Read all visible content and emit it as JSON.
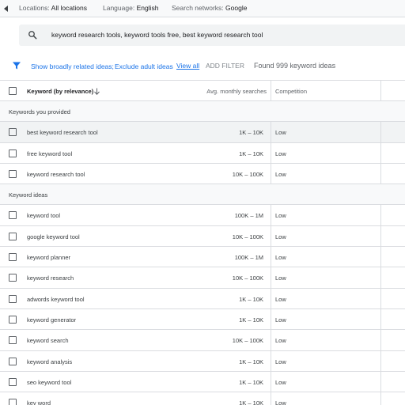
{
  "topbar": {
    "locations_label": "Locations:",
    "locations_value": "All locations",
    "language_label": "Language:",
    "language_value": "English",
    "networks_label": "Search networks:",
    "networks_value": "Google"
  },
  "search": {
    "query": "keyword research tools, keyword tools free, best keyword research tool"
  },
  "filters": {
    "broadly_related": "Show broadly related ideas;",
    "exclude_adult": "Exclude adult ideas",
    "view_all": "View all",
    "add_filter": "ADD FILTER",
    "found": "Found 999 keyword ideas"
  },
  "table": {
    "headers": {
      "keyword": "Keyword (by relevance)",
      "volume": "Avg. monthly searches",
      "competition": "Competition"
    },
    "provided_label": "Keywords you provided",
    "ideas_label": "Keyword ideas",
    "provided": [
      {
        "keyword": "best keyword research tool",
        "volume": "1K – 10K",
        "competition": "Low"
      },
      {
        "keyword": "free keyword tool",
        "volume": "1K – 10K",
        "competition": "Low"
      },
      {
        "keyword": "keyword research tool",
        "volume": "10K – 100K",
        "competition": "Low"
      }
    ],
    "ideas": [
      {
        "keyword": "keyword tool",
        "volume": "100K – 1M",
        "competition": "Low"
      },
      {
        "keyword": "google keyword tool",
        "volume": "10K – 100K",
        "competition": "Low"
      },
      {
        "keyword": "keyword planner",
        "volume": "100K – 1M",
        "competition": "Low"
      },
      {
        "keyword": "keyword research",
        "volume": "10K – 100K",
        "competition": "Low"
      },
      {
        "keyword": "adwords keyword tool",
        "volume": "1K – 10K",
        "competition": "Low"
      },
      {
        "keyword": "keyword generator",
        "volume": "1K – 10K",
        "competition": "Low"
      },
      {
        "keyword": "keyword search",
        "volume": "10K – 100K",
        "competition": "Low"
      },
      {
        "keyword": "keyword analysis",
        "volume": "1K – 10K",
        "competition": "Low"
      },
      {
        "keyword": "seo keyword tool",
        "volume": "1K – 10K",
        "competition": "Low"
      },
      {
        "keyword": "key word",
        "volume": "1K – 10K",
        "competition": "Low"
      }
    ]
  },
  "colors": {
    "accent": "#1a73e8",
    "border": "#dadce0",
    "search_bg": "#f1f3f4",
    "group_bg": "#f8f9fa"
  }
}
